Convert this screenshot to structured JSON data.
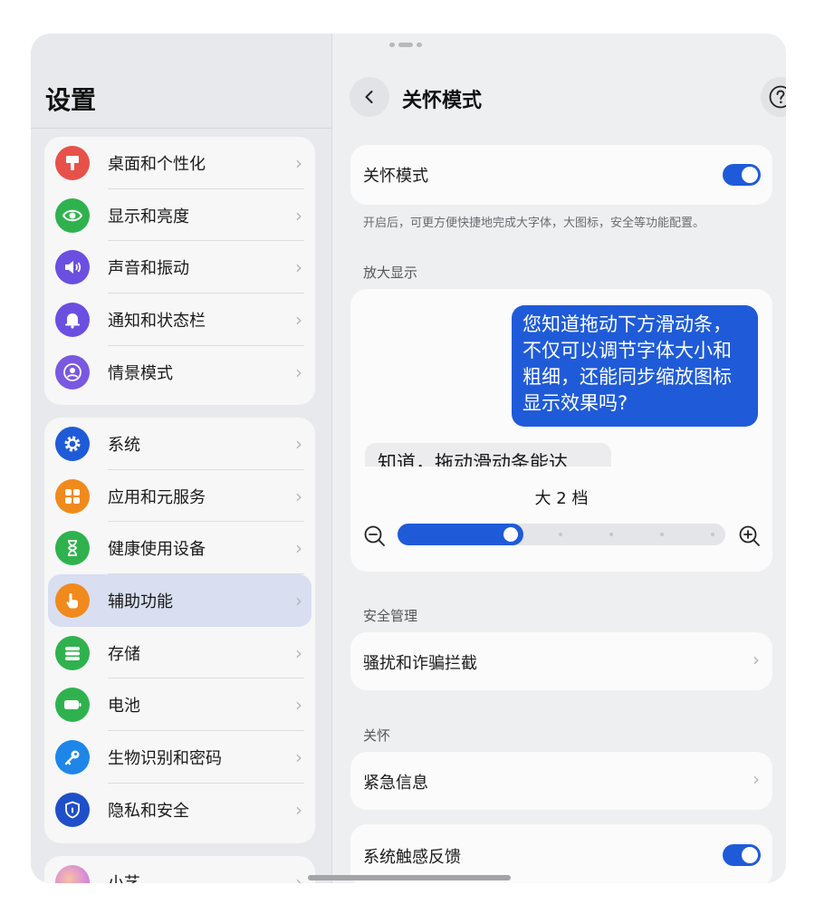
{
  "sidebar": {
    "title": "设置",
    "groups": [
      {
        "items": [
          {
            "label": "桌面和个性化",
            "icon": "paintbrush-icon",
            "color": "#e8514a"
          },
          {
            "label": "显示和亮度",
            "icon": "eye-icon",
            "color": "#2fb24e"
          },
          {
            "label": "声音和振动",
            "icon": "speaker-icon",
            "color": "#6b4fe0"
          },
          {
            "label": "通知和状态栏",
            "icon": "bell-icon",
            "color": "#6b4fe0"
          },
          {
            "label": "情景模式",
            "icon": "scene-icon",
            "color": "#7a58e0"
          }
        ]
      },
      {
        "items": [
          {
            "label": "系统",
            "icon": "gear-icon",
            "color": "#1f5bd8"
          },
          {
            "label": "应用和元服务",
            "icon": "apps-grid-icon",
            "color": "#f08a1d"
          },
          {
            "label": "健康使用设备",
            "icon": "hourglass-icon",
            "color": "#2fb24e"
          },
          {
            "label": "辅助功能",
            "icon": "hand-pointer-icon",
            "color": "#f08a1d",
            "selected": true
          },
          {
            "label": "存储",
            "icon": "storage-icon",
            "color": "#2fb24e"
          },
          {
            "label": "电池",
            "icon": "battery-icon",
            "color": "#2fb24e"
          },
          {
            "label": "生物识别和密码",
            "icon": "key-icon",
            "color": "#1e86e8"
          },
          {
            "label": "隐私和安全",
            "icon": "shield-icon",
            "color": "#1f4fc8"
          }
        ]
      },
      {
        "items": [
          {
            "label": "小艺",
            "icon": "assistant-icon",
            "color": "#e29ad0"
          }
        ]
      }
    ]
  },
  "main": {
    "title": "关怀模式",
    "care_mode": {
      "label": "关怀模式",
      "enabled": true
    },
    "care_note": "开启后，可更方便快捷地完成大字体，大图标，安全等功能配置。",
    "zoom_section": "放大显示",
    "preview": {
      "question": "您知道拖动下方滑动条，不仅可以调节字体大小和粗细，还能同步缩放图标显示效果吗?",
      "answer": "知道，拖动滑动条能达"
    },
    "zoom_level": "大 2 档",
    "slider": {
      "value": 2,
      "steps": 7
    },
    "security_section": "安全管理",
    "harass_label": "骚扰和诈骗拦截",
    "care_section": "关怀",
    "emergency_label": "紧急信息",
    "haptic": {
      "label": "系统触感反馈",
      "enabled": true
    },
    "accent_color": "#1f5bd8"
  }
}
